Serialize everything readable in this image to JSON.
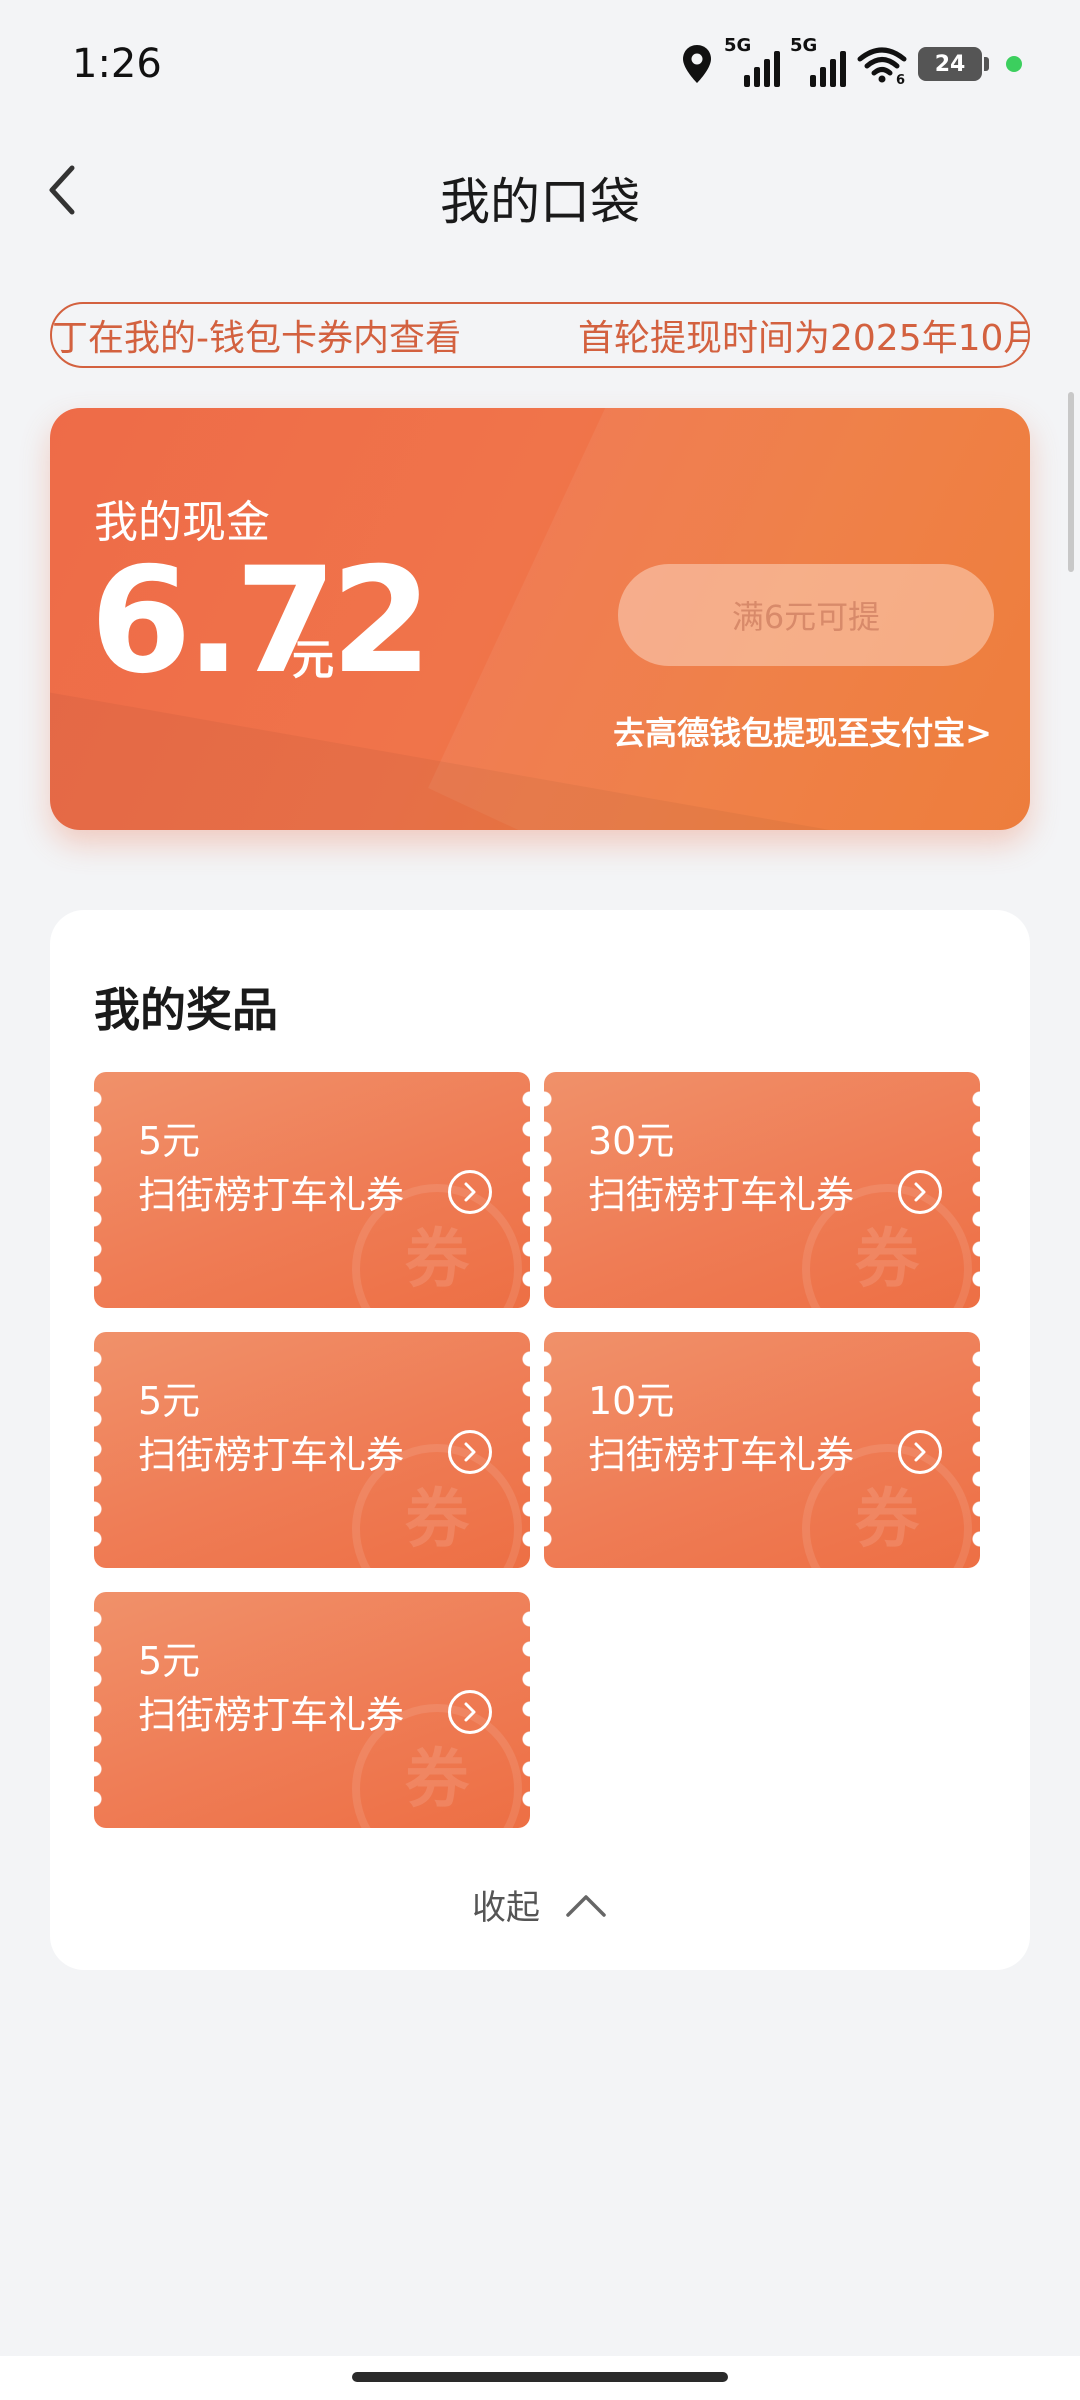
{
  "status_bar": {
    "time": "1:26",
    "network_1": "5G",
    "network_2": "5G",
    "wifi_badge": "6",
    "battery": "24",
    "dot_color": "#3ccf5e"
  },
  "header": {
    "back_icon": "chevron-left-icon",
    "title": "我的口袋"
  },
  "marquee": {
    "segment_1": "丁在我的-钱包卡券内查看",
    "segment_2": "首轮提现时间为2025年10月"
  },
  "cash_card": {
    "label": "我的现金",
    "amount": "6.72",
    "unit": "元",
    "withdraw_button": "满6元可提",
    "alipay_link": "去高德钱包提现至支付宝>",
    "accent": "#ef7446"
  },
  "prizes": {
    "title": "我的奖品",
    "watermark": "券",
    "coupons": [
      {
        "amount": "5元",
        "name": "扫街榜打车礼券"
      },
      {
        "amount": "30元",
        "name": "扫街榜打车礼券"
      },
      {
        "amount": "5元",
        "name": "扫街榜打车礼券"
      },
      {
        "amount": "10元",
        "name": "扫街榜打车礼券"
      },
      {
        "amount": "5元",
        "name": "扫街榜打车礼券"
      }
    ],
    "collapse_label": "收起",
    "collapse_icon": "chevron-up-icon"
  }
}
